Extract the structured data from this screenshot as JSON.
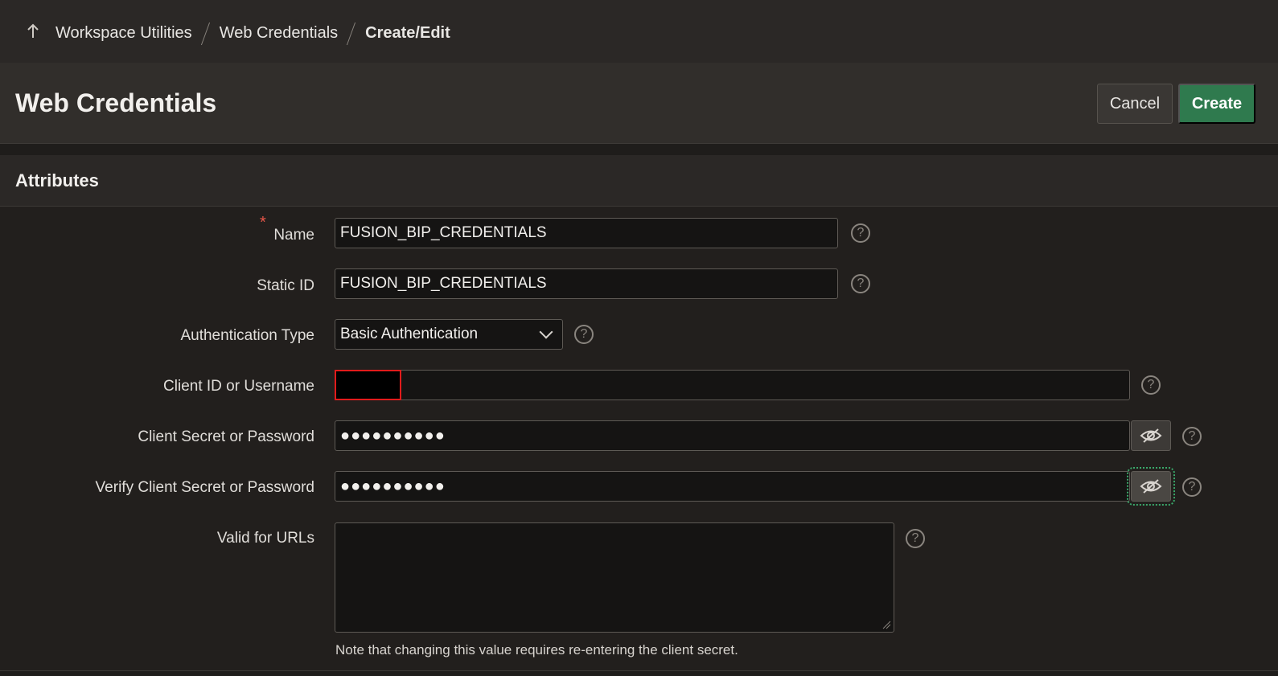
{
  "breadcrumb": {
    "items": [
      "Workspace Utilities",
      "Web Credentials",
      "Create/Edit"
    ]
  },
  "page": {
    "title": "Web Credentials",
    "cancel_label": "Cancel",
    "create_label": "Create"
  },
  "region": {
    "title": "Attributes"
  },
  "form": {
    "required_marker": "*",
    "name": {
      "label": "Name",
      "value": "FUSION_BIP_CREDENTIALS"
    },
    "static_id": {
      "label": "Static ID",
      "value": "FUSION_BIP_CREDENTIALS"
    },
    "auth_type": {
      "label": "Authentication Type",
      "value": "Basic Authentication"
    },
    "client_id": {
      "label": "Client ID or Username",
      "value": ""
    },
    "client_secret": {
      "label": "Client Secret or Password",
      "value": "●●●●●●●●●●"
    },
    "verify_secret": {
      "label": "Verify Client Secret or Password",
      "value": "●●●●●●●●●●"
    },
    "valid_urls": {
      "label": "Valid for URLs",
      "value": ""
    },
    "note": "Note that changing this value requires re-entering the client secret.",
    "help_glyph": "?"
  },
  "colors": {
    "accent_create": "#2f7a4e",
    "focus_outline": "#3aa86a",
    "redaction_border": "#e11b1b"
  },
  "icons": {
    "up": "arrow-up-icon",
    "help": "help-icon",
    "eye": "eye-slash-icon",
    "chevron": "chevron-down-icon"
  }
}
